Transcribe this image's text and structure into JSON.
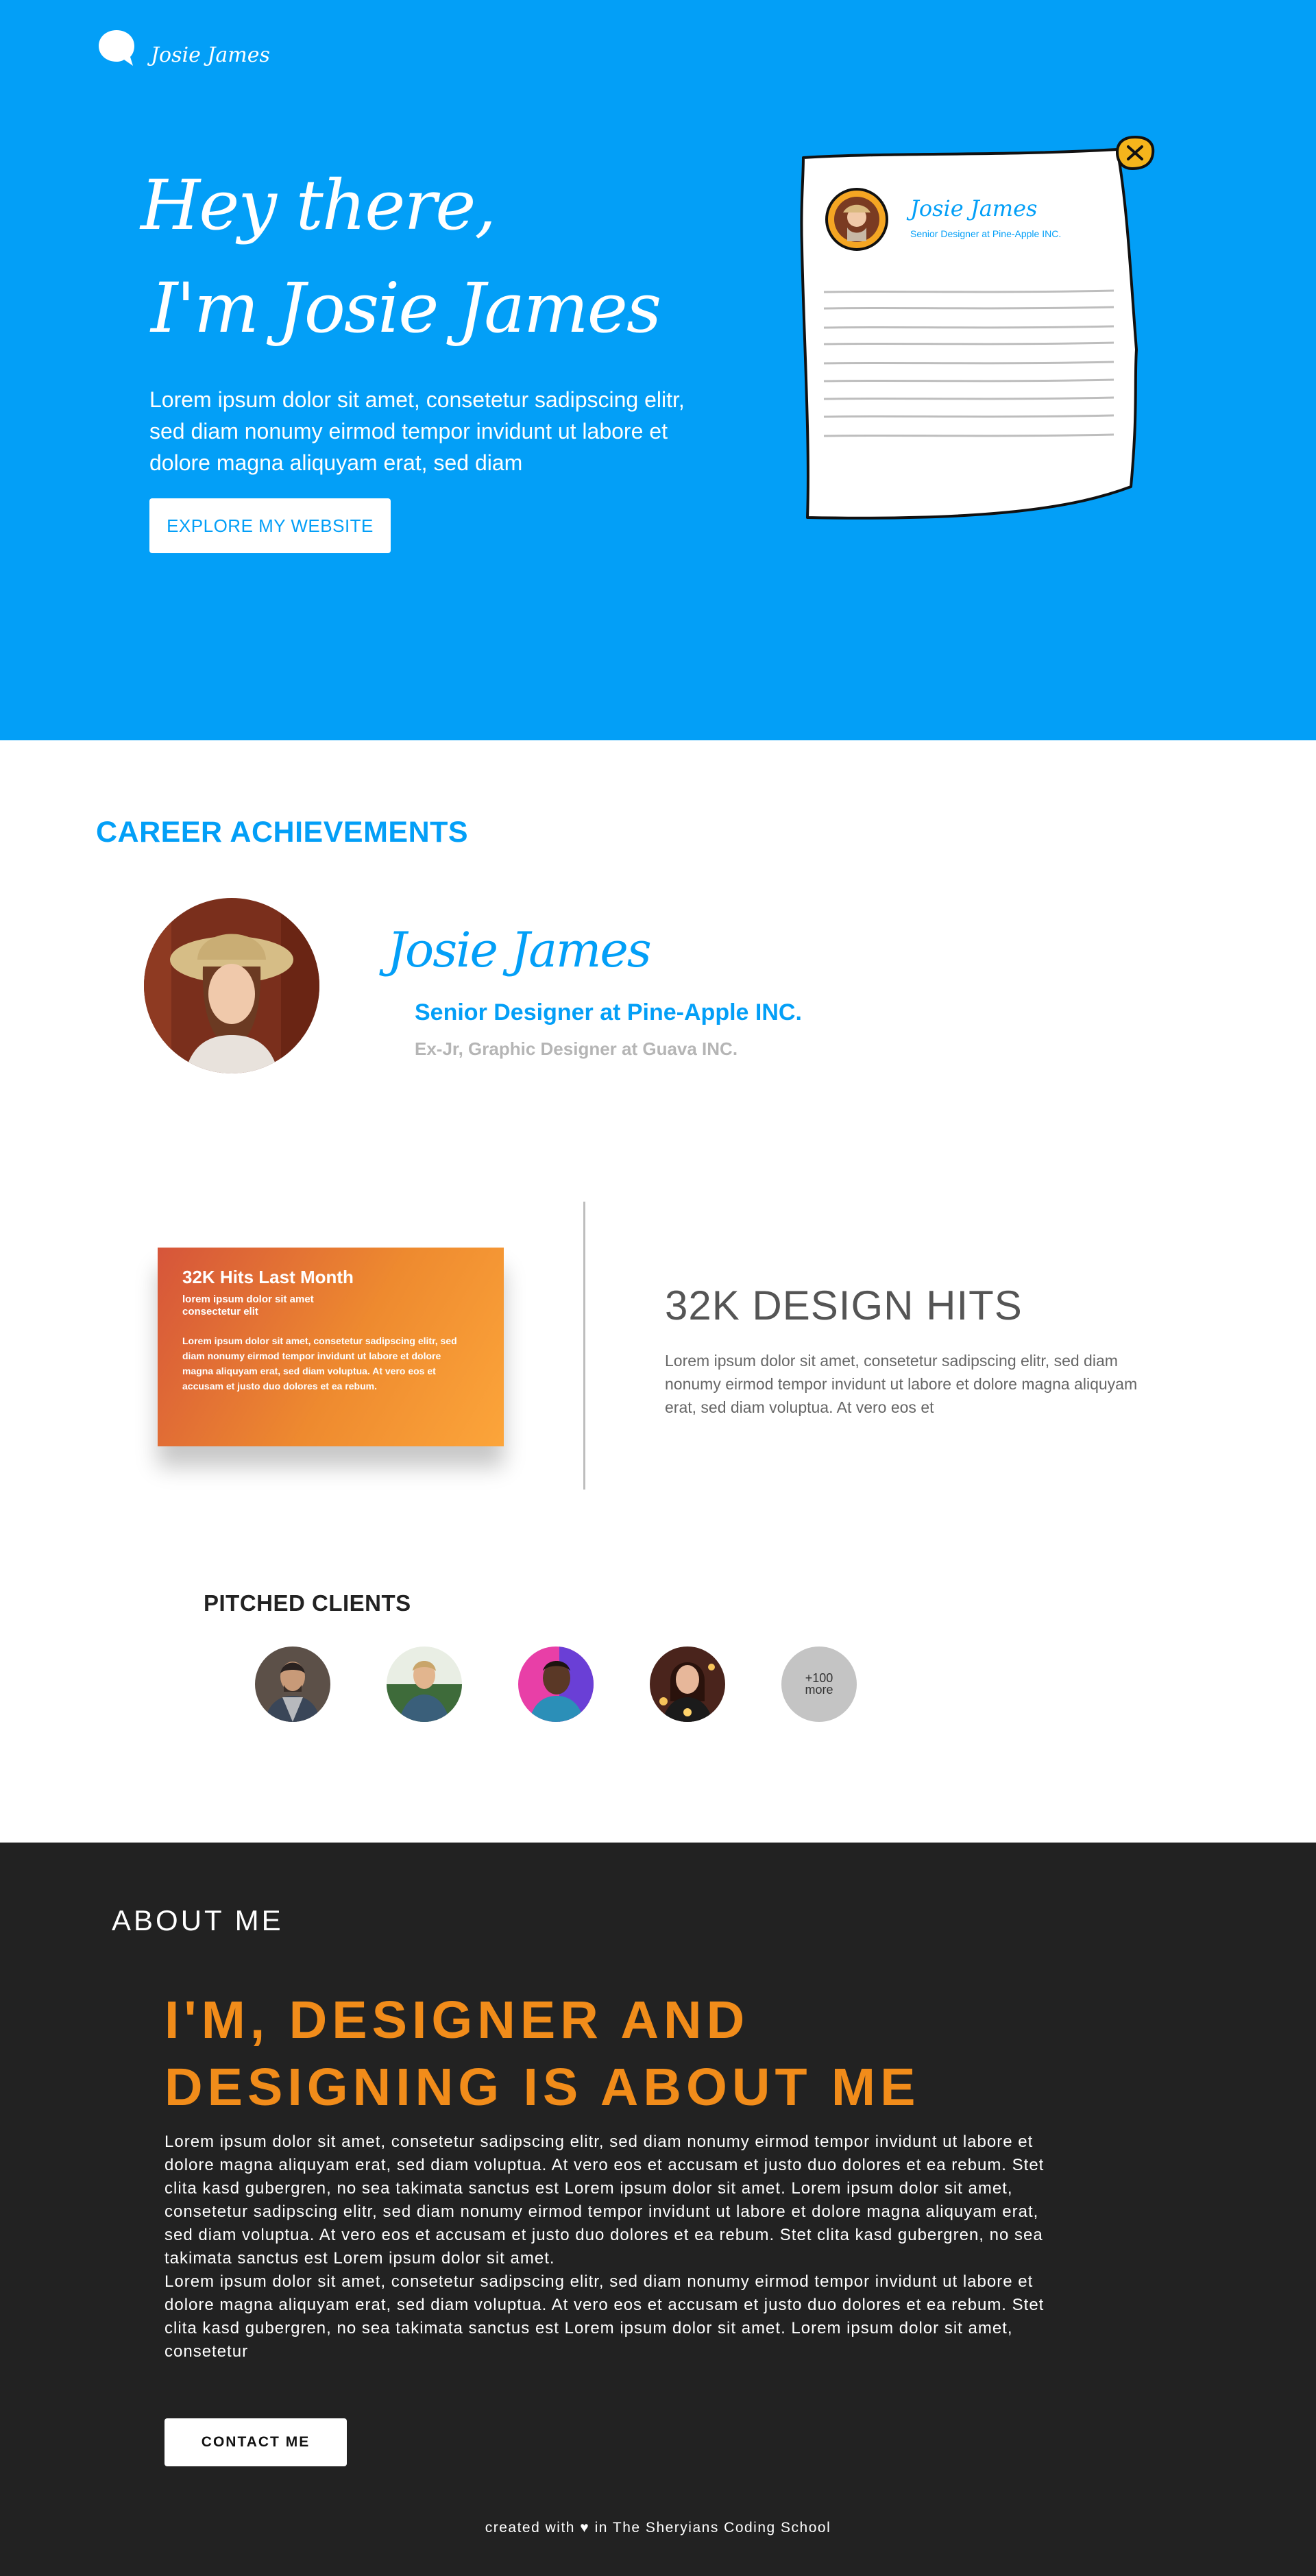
{
  "brand": {
    "logo_text": "Josie James",
    "primary_color": "#039ff7",
    "accent_color": "#f18c1a",
    "dark_bg": "#222222"
  },
  "hero": {
    "greeting_line1": "Hey there,",
    "greeting_line2": "I'm Josie James",
    "text": "Lorem ipsum dolor sit amet, consetetur sadipscing elitr, sed diam nonumy eirmod tempor invidunt ut labore et dolore magna aliquyam erat, sed diam",
    "button_label": "EXPLORE MY WEBSITE",
    "card": {
      "name": "Josie James",
      "role": "Senior Designer at Pine-Apple INC.",
      "close_icon": "close-icon"
    }
  },
  "career": {
    "title": "CAREER ACHIEVEMENTS",
    "name": "Josie James",
    "current_role": "Senior Designer at Pine-Apple INC.",
    "past_role": "Ex-Jr, Graphic Designer at Guava INC.",
    "hits_card": {
      "title": "32K Hits Last Month",
      "subtitle": "lorem ipsum dolor sit amet consectetur elit",
      "body": "Lorem ipsum dolor sit amet, consetetur sadipscing elitr, sed diam nonumy eirmod tempor invidunt ut labore et dolore magna aliquyam erat, sed diam voluptua. At vero eos et accusam et justo duo dolores et ea rebum."
    },
    "hits_title": "32K DESIGN HITS",
    "hits_text": "Lorem ipsum dolor sit amet, consetetur sadipscing elitr, sed diam nonumy eirmod tempor invidunt ut labore et dolore magna aliquyam erat, sed diam voluptua. At vero eos et",
    "clients_title": "PITCHED CLIENTS",
    "more_count": "+100",
    "more_label": "more"
  },
  "about": {
    "title": "ABOUT ME",
    "heading_line1": "I'M, DESIGNER AND",
    "heading_line2": "DESIGNING IS ABOUT ME",
    "text": "Lorem ipsum dolor sit amet, consetetur sadipscing elitr, sed diam nonumy eirmod tempor invidunt ut labore et dolore magna aliquyam erat, sed diam voluptua. At vero eos et accusam et justo duo dolores et ea rebum. Stet clita kasd gubergren, no sea takimata sanctus est Lorem ipsum dolor sit amet. Lorem ipsum dolor sit amet, consetetur sadipscing elitr, sed diam nonumy eirmod tempor invidunt ut labore et dolore magna aliquyam erat, sed diam voluptua. At vero eos et accusam et justo duo dolores et ea rebum. Stet clita kasd gubergren, no sea takimata sanctus est Lorem ipsum dolor sit amet.\nLorem ipsum dolor sit amet, consetetur sadipscing elitr, sed diam nonumy eirmod tempor invidunt ut labore et dolore magna aliquyam erat, sed diam voluptua. At vero eos et accusam et justo duo dolores et ea rebum. Stet clita kasd gubergren, no sea takimata sanctus est Lorem ipsum dolor sit amet. Lorem ipsum dolor sit amet, consetetur",
    "button_label": "CONTACT ME"
  },
  "footer": {
    "text": "created with ♥ in The Sheryians Coding School"
  }
}
